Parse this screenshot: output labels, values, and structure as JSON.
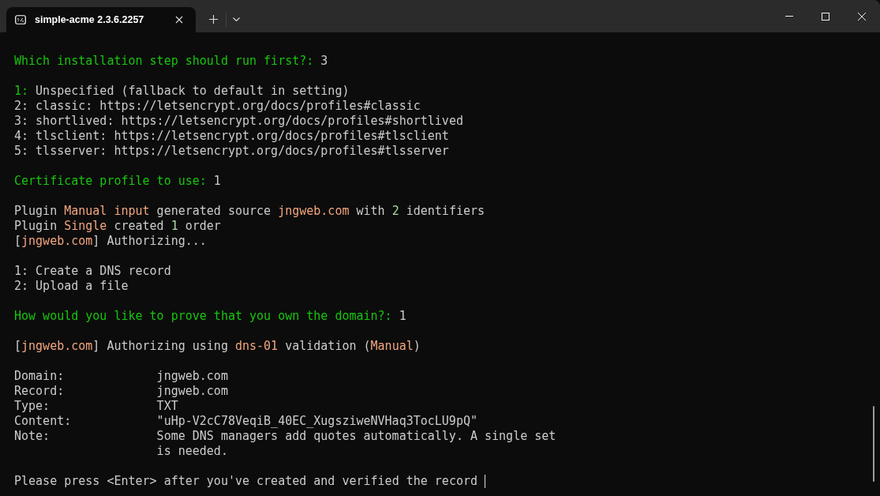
{
  "window": {
    "tab": {
      "title": "simple-acme 2.3.6.2257",
      "selected": true
    }
  },
  "terminal": {
    "blocks": [
      {
        "kind": "lines",
        "lines": [
          {
            "segments": [
              {
                "kind": "prompt",
                "text": "Which installation step should run first?:"
              },
              {
                "kind": "plain",
                "text": " 3"
              }
            ]
          }
        ]
      },
      {
        "kind": "lines",
        "lines": [
          {
            "segments": [
              {
                "kind": "prompt",
                "text": "1:"
              },
              {
                "kind": "plain",
                "text": " Unspecified (fallback to default in setting)"
              }
            ]
          },
          {
            "segments": [
              {
                "kind": "plain",
                "text": "2: classic: https://letsencrypt.org/docs/profiles#classic"
              }
            ]
          },
          {
            "segments": [
              {
                "kind": "plain",
                "text": "3: shortlived: https://letsencrypt.org/docs/profiles#shortlived"
              }
            ]
          },
          {
            "segments": [
              {
                "kind": "plain",
                "text": "4: tlsclient: https://letsencrypt.org/docs/profiles#tlsclient"
              }
            ]
          },
          {
            "segments": [
              {
                "kind": "plain",
                "text": "5: tlsserver: https://letsencrypt.org/docs/profiles#tlsserver"
              }
            ]
          }
        ]
      },
      {
        "kind": "lines",
        "lines": [
          {
            "segments": [
              {
                "kind": "prompt",
                "text": "Certificate profile to use:"
              },
              {
                "kind": "plain",
                "text": " 1"
              }
            ]
          }
        ]
      },
      {
        "kind": "lines",
        "lines": [
          {
            "segments": [
              {
                "kind": "plain",
                "text": "Plugin "
              },
              {
                "kind": "accent",
                "text": "Manual input"
              },
              {
                "kind": "plain",
                "text": " generated source "
              },
              {
                "kind": "accent",
                "text": "jngweb.com"
              },
              {
                "kind": "plain",
                "text": " with "
              },
              {
                "kind": "number",
                "text": "2"
              },
              {
                "kind": "plain",
                "text": " identifiers"
              }
            ]
          },
          {
            "segments": [
              {
                "kind": "plain",
                "text": "Plugin "
              },
              {
                "kind": "accent",
                "text": "Single"
              },
              {
                "kind": "plain",
                "text": " created "
              },
              {
                "kind": "number",
                "text": "1"
              },
              {
                "kind": "plain",
                "text": " order"
              }
            ]
          },
          {
            "segments": [
              {
                "kind": "plain",
                "text": "["
              },
              {
                "kind": "accent",
                "text": "jngweb.com"
              },
              {
                "kind": "plain",
                "text": "] Authorizing..."
              }
            ]
          }
        ]
      },
      {
        "kind": "lines",
        "lines": [
          {
            "segments": [
              {
                "kind": "plain",
                "text": "1: Create a DNS record"
              }
            ]
          },
          {
            "segments": [
              {
                "kind": "plain",
                "text": "2: Upload a file"
              }
            ]
          }
        ]
      },
      {
        "kind": "lines",
        "lines": [
          {
            "segments": [
              {
                "kind": "prompt",
                "text": "How would you like to prove that you own the domain?:"
              },
              {
                "kind": "plain",
                "text": " 1"
              }
            ]
          }
        ]
      },
      {
        "kind": "lines",
        "lines": [
          {
            "segments": [
              {
                "kind": "plain",
                "text": "["
              },
              {
                "kind": "accent",
                "text": "jngweb.com"
              },
              {
                "kind": "plain",
                "text": "] Authorizing using "
              },
              {
                "kind": "accent",
                "text": "dns-01"
              },
              {
                "kind": "plain",
                "text": " validation ("
              },
              {
                "kind": "accent",
                "text": "Manual"
              },
              {
                "kind": "plain",
                "text": ")"
              }
            ]
          }
        ]
      },
      {
        "kind": "fields",
        "rows": [
          {
            "label": "Domain:",
            "value": "jngweb.com"
          },
          {
            "label": "Record:",
            "value": "jngweb.com"
          },
          {
            "label": "Type:",
            "value": "TXT"
          },
          {
            "label": "Content:",
            "value": "\"uHp-V2cC78VeqiB_40EC_XugsziweNVHaq3TocLU9pQ\""
          },
          {
            "label": "Note:",
            "value": "Some DNS managers add quotes automatically. A single set is needed."
          }
        ]
      },
      {
        "kind": "input",
        "text": "Please press <Enter> after you've created and verified the record"
      }
    ]
  }
}
